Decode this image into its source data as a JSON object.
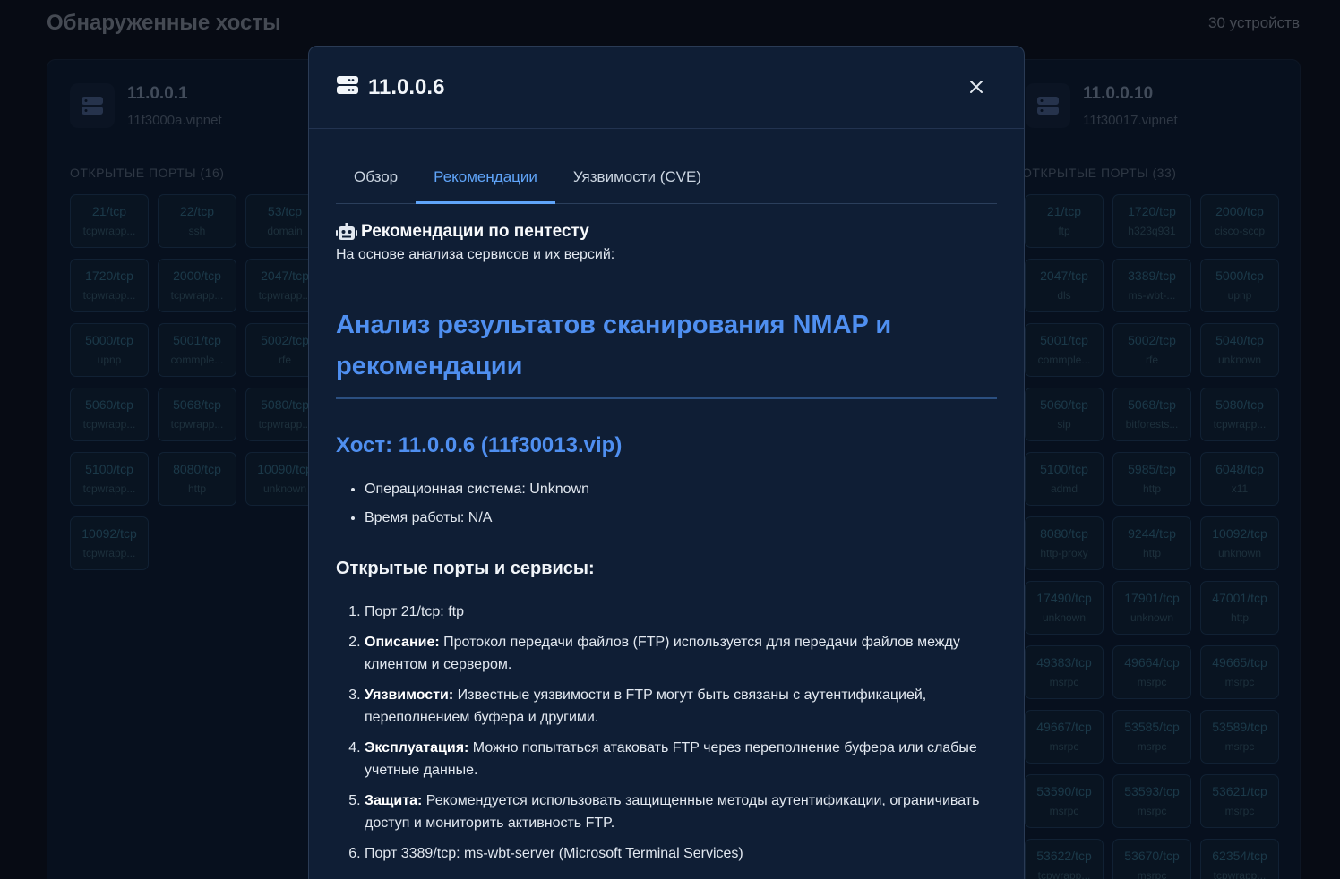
{
  "page": {
    "title": "Обнаруженные хосты",
    "device_count": "30 устройств"
  },
  "host_left": {
    "ip": "11.0.0.1",
    "hostname": "11f3000a.vipnet",
    "ports_label": "ОТКРЫТЫЕ ПОРТЫ (16)",
    "ports": [
      {
        "port": "21/tcp",
        "service": "tcpwrapp..."
      },
      {
        "port": "22/tcp",
        "service": "ssh"
      },
      {
        "port": "53/tcp",
        "service": "domain"
      },
      {
        "port": "1720/tcp",
        "service": "tcpwrapp..."
      },
      {
        "port": "2000/tcp",
        "service": "tcpwrapp..."
      },
      {
        "port": "2047/tcp",
        "service": "tcpwrapp..."
      },
      {
        "port": "5000/tcp",
        "service": "upnp"
      },
      {
        "port": "5001/tcp",
        "service": "commple..."
      },
      {
        "port": "5002/tcp",
        "service": "rfe"
      },
      {
        "port": "5060/tcp",
        "service": "tcpwrapp..."
      },
      {
        "port": "5068/tcp",
        "service": "tcpwrapp..."
      },
      {
        "port": "5080/tcp",
        "service": "tcpwrapp..."
      },
      {
        "port": "5100/tcp",
        "service": "tcpwrapp..."
      },
      {
        "port": "8080/tcp",
        "service": "http"
      },
      {
        "port": "10090/tcp",
        "service": "unknown"
      },
      {
        "port": "10092/tcp",
        "service": "tcpwrapp..."
      }
    ]
  },
  "host_right": {
    "ip": "11.0.0.10",
    "hostname": "11f30017.vipnet",
    "ports_label": "ОТКРЫТЫЕ ПОРТЫ (33)",
    "ports": [
      {
        "port": "21/tcp",
        "service": "ftp"
      },
      {
        "port": "1720/tcp",
        "service": "h323q931"
      },
      {
        "port": "2000/tcp",
        "service": "cisco-sccp"
      },
      {
        "port": "2047/tcp",
        "service": "dls"
      },
      {
        "port": "3389/tcp",
        "service": "ms-wbt-..."
      },
      {
        "port": "5000/tcp",
        "service": "upnp"
      },
      {
        "port": "5001/tcp",
        "service": "commple..."
      },
      {
        "port": "5002/tcp",
        "service": "rfe"
      },
      {
        "port": "5040/tcp",
        "service": "unknown"
      },
      {
        "port": "5060/tcp",
        "service": "sip"
      },
      {
        "port": "5068/tcp",
        "service": "bitforests..."
      },
      {
        "port": "5080/tcp",
        "service": "tcpwrapp..."
      },
      {
        "port": "5100/tcp",
        "service": "admd"
      },
      {
        "port": "5985/tcp",
        "service": "http"
      },
      {
        "port": "6048/tcp",
        "service": "x11"
      },
      {
        "port": "8080/tcp",
        "service": "http-proxy"
      },
      {
        "port": "9244/tcp",
        "service": "http"
      },
      {
        "port": "10092/tcp",
        "service": "unknown"
      },
      {
        "port": "17490/tcp",
        "service": "unknown"
      },
      {
        "port": "17901/tcp",
        "service": "unknown"
      },
      {
        "port": "47001/tcp",
        "service": "http"
      },
      {
        "port": "49383/tcp",
        "service": "msrpc"
      },
      {
        "port": "49664/tcp",
        "service": "msrpc"
      },
      {
        "port": "49665/tcp",
        "service": "msrpc"
      },
      {
        "port": "49667/tcp",
        "service": "msrpc"
      },
      {
        "port": "53585/tcp",
        "service": "msrpc"
      },
      {
        "port": "53589/tcp",
        "service": "msrpc"
      },
      {
        "port": "53590/tcp",
        "service": "msrpc"
      },
      {
        "port": "53593/tcp",
        "service": "msrpc"
      },
      {
        "port": "53621/tcp",
        "service": "msrpc"
      },
      {
        "port": "53622/tcp",
        "service": "tcpwrapp..."
      },
      {
        "port": "53670/tcp",
        "service": "msrpc"
      },
      {
        "port": "62354/tcp",
        "service": "tcpwrapp..."
      }
    ]
  },
  "modal": {
    "title": "11.0.0.6",
    "close_icon": "×",
    "tabs": [
      "Обзор",
      "Рекомендации",
      "Уязвимости (CVE)"
    ],
    "active_tab": 1,
    "rec_title": "Рекомендации по пентесту",
    "rec_subtitle": "На основе анализа сервисов и их версий:",
    "heading1": "Анализ результатов сканирования NMAP и рекомендации",
    "heading2": "Хост: 11.0.0.6 (11f30013.vip)",
    "host_info": [
      "Операционная система: Unknown",
      "Время работы: N/A"
    ],
    "heading3": "Открытые порты и сервисы:",
    "items": [
      {
        "label": "",
        "text": "Порт 21/tcp: ftp"
      },
      {
        "label": "Описание:",
        "text": " Протокол передачи файлов (FTP) используется для передачи файлов между клиентом и сервером."
      },
      {
        "label": "Уязвимости:",
        "text": " Известные уязвимости в FTP могут быть связаны с аутентификацией, переполнением буфера и другими."
      },
      {
        "label": "Эксплуатация:",
        "text": " Можно попытаться атаковать FTP через переполнение буфера или слабые учетные данные."
      },
      {
        "label": "Защита:",
        "text": " Рекомендуется использовать защищенные методы аутентификации, ограничивать доступ и мониторить активность FTP."
      },
      {
        "label": "",
        "text": "Порт 3389/tcp: ms-wbt-server (Microsoft Terminal Services)"
      }
    ]
  },
  "icons": {
    "server": "server-icon",
    "robot": "robot-icon",
    "close": "close-icon"
  },
  "colors": {
    "accent": "#60a5fa",
    "heading": "#4f8ff0",
    "modal_bg": "#0f1e35",
    "page_bg": "#0b1220"
  }
}
